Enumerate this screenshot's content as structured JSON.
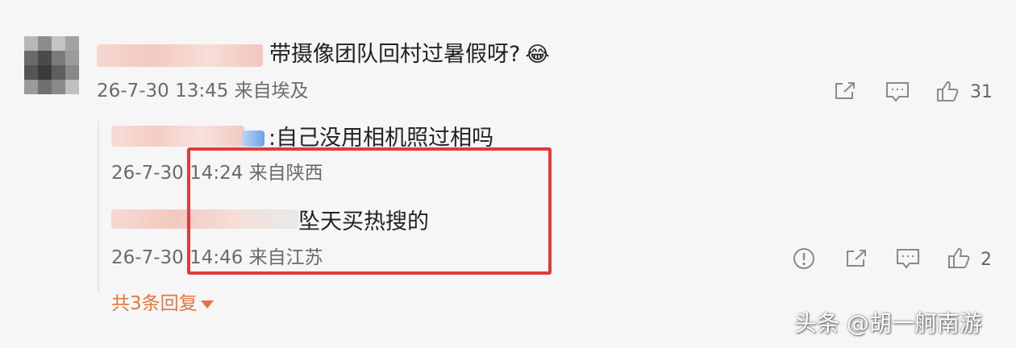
{
  "comment": {
    "text": "带摄像团队回村过暑假呀?",
    "emoji": "😂",
    "meta": "26-7-30 13:45 来自埃及",
    "like_count": "31"
  },
  "replies": [
    {
      "text": ":自己没用相机照过相吗",
      "meta": "26-7-30 14:24 来自陕西"
    },
    {
      "text": "坠天买热搜的",
      "meta": "26-7-30 14:46 来自江苏",
      "like_count": "2"
    }
  ],
  "more_replies": "共3条回复",
  "watermark": "头条 @胡一舸南游",
  "colors": {
    "accent": "#e8743b",
    "highlight_box": "#e23a3a",
    "background": "#f6f6f6"
  },
  "icons": [
    "share-icon",
    "comment-icon",
    "thumbs-up-icon",
    "report-icon"
  ]
}
